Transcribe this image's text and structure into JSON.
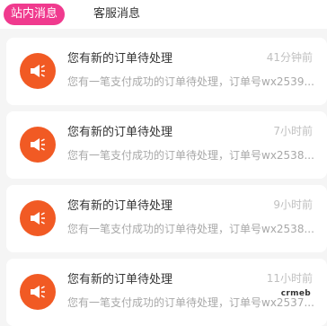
{
  "tabs": [
    {
      "label": "站内消息",
      "active": true
    },
    {
      "label": "客服消息",
      "active": false
    }
  ],
  "messages": [
    {
      "title": "您有新的订单待处理",
      "time": "41分钟前",
      "desc": "您有一笔支付成功的订单待处理，订单号wx2539...",
      "icon": "speaker-icon"
    },
    {
      "title": "您有新的订单待处理",
      "time": "7小时前",
      "desc": "您有一笔支付成功的订单待处理，订单号wx2538...",
      "icon": "speaker-icon"
    },
    {
      "title": "您有新的订单待处理",
      "time": "9小时前",
      "desc": "您有一笔支付成功的订单待处理，订单号wx2538...",
      "icon": "speaker-icon"
    },
    {
      "title": "您有新的订单待处理",
      "time": "11小时前",
      "desc": "您有一笔支付成功的订单待处理，订单号wx2537...",
      "icon": "speaker-icon"
    }
  ],
  "watermark": "crmeb",
  "colors": {
    "accent": "#f03a8e",
    "icon_bg": "#f15a24",
    "page_bg": "#f5f5f5"
  }
}
